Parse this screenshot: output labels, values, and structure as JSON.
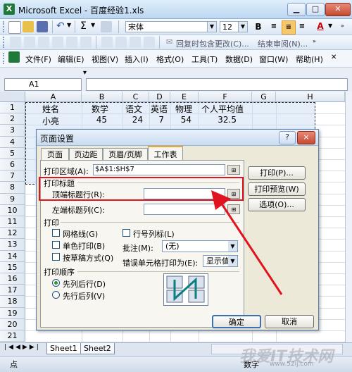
{
  "window": {
    "app_icon": "X",
    "title": "Microsoft Excel - 百度经验1.xls",
    "min_icon": "minimize-icon",
    "max_icon": "maximize-icon",
    "close_icon": "close-icon"
  },
  "toolbar_top": {
    "font_name": "宋体",
    "font_size": "12",
    "bold_label": "B",
    "font_color_label": "A"
  },
  "toolbar_second": {
    "reply_label": "回复时包含更改(C)...",
    "end_review_label": "结束审阅(N)..."
  },
  "menu": {
    "items": [
      "文件(F)",
      "编辑(E)",
      "视图(V)",
      "插入(I)",
      "格式(O)",
      "工具(T)",
      "数据(D)",
      "窗口(W)",
      "帮助(H)"
    ]
  },
  "name_box": "A1",
  "grid": {
    "columns": [
      "A",
      "B",
      "C",
      "D",
      "E",
      "F",
      "G",
      "H"
    ],
    "rows": [
      "1",
      "2",
      "3",
      "4",
      "5",
      "6",
      "7",
      "8",
      "9",
      "10",
      "11",
      "12",
      "13",
      "14",
      "15",
      "16",
      "17",
      "18",
      "19",
      "20",
      "21"
    ],
    "header_row": [
      "姓名",
      "数学",
      "语文",
      "英语",
      "物理",
      "个人平均值"
    ],
    "data_row": [
      "小亮",
      "45",
      "24",
      "7",
      "54",
      "32.5"
    ]
  },
  "sheet_tabs": [
    "Sheet1",
    "Sheet2"
  ],
  "status": {
    "left": "点",
    "right": "数字"
  },
  "dialog": {
    "title": "页面设置",
    "help_label": "?",
    "close_label": "×",
    "tabs": [
      "页面",
      "页边距",
      "页眉/页脚",
      "工作表"
    ],
    "print_area_label": "打印区域(A):",
    "print_area_value": "$A$1:$H$7",
    "print_titles_header": "打印标题",
    "top_rows_label": "顶端标题行(R):",
    "left_cols_label": "左端标题列(C):",
    "print_header": "打印",
    "gridlines_label": "网格线(G)",
    "mono_label": "单色打印(B)",
    "draft_label": "按草稿方式(Q)",
    "row_col_headers_label": "行号列标(L)",
    "comments_label": "批注(M):",
    "comments_value": "(无)",
    "errors_label": "错误单元格打印为(E):",
    "errors_value": "显示值",
    "order_header": "打印顺序",
    "down_then_over_label": "先列后行(D)",
    "over_then_down_label": "先行后列(V)",
    "print_button": "打印(P)...",
    "preview_button": "打印预览(W)",
    "options_button": "选项(O)...",
    "ok_button": "确定",
    "cancel_button": "取消"
  },
  "watermark": {
    "main": "我爱IT技术网",
    "url": "www.52ij.com"
  },
  "colors": {
    "annotation_red": "#e0141e",
    "title_bar": "#c9dcf1",
    "selection_blue": "#c5d9f1"
  }
}
